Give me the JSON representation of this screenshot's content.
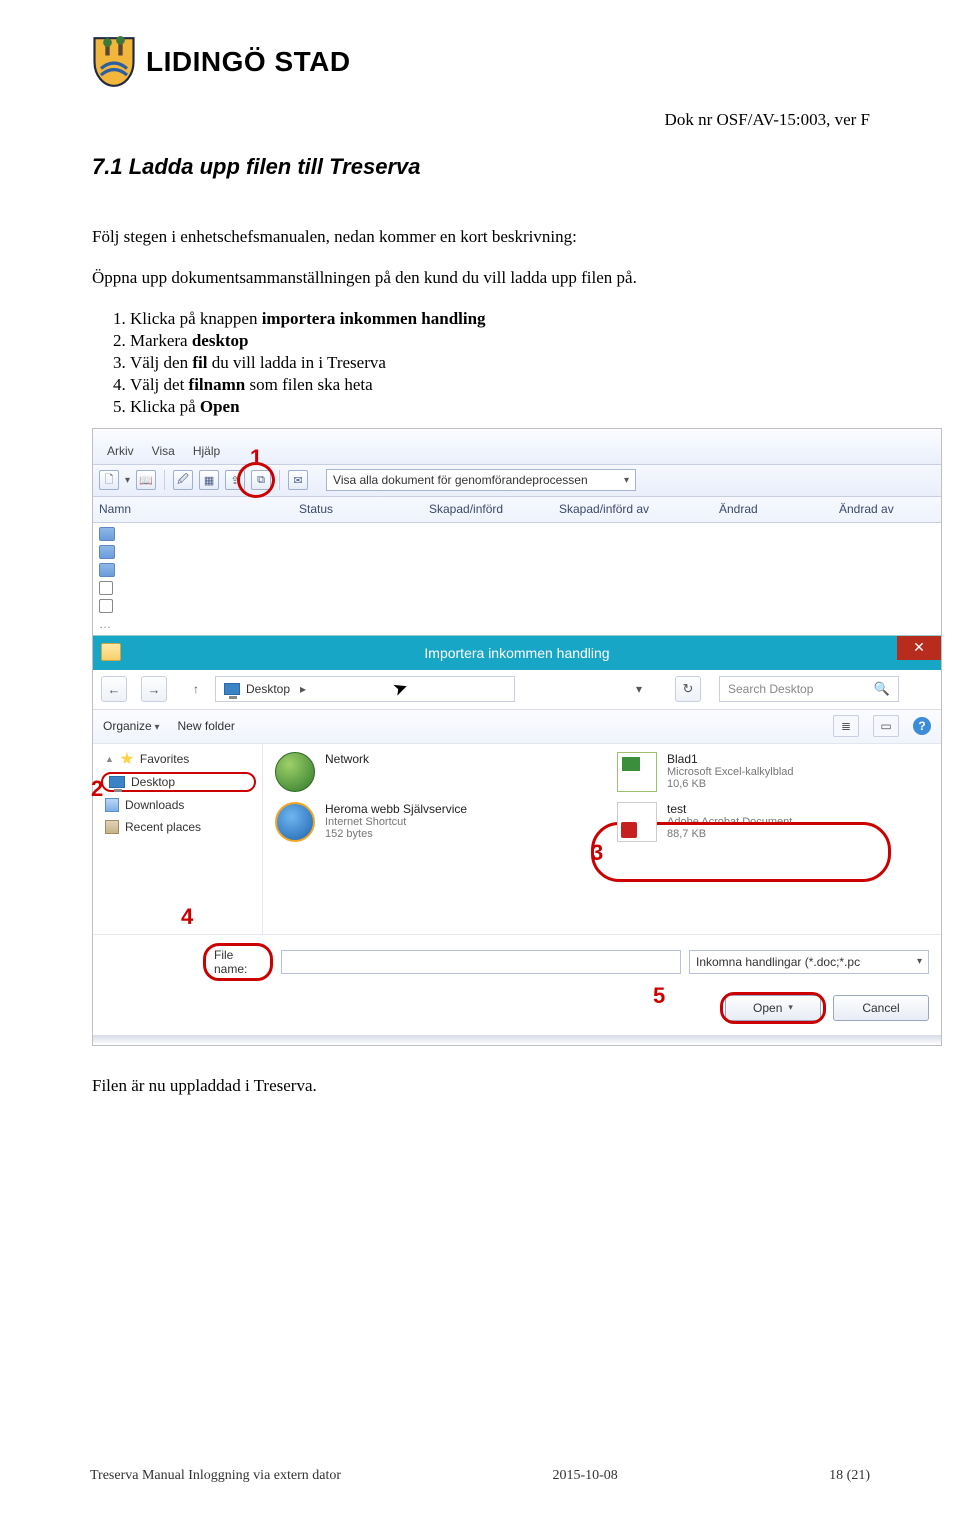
{
  "header": {
    "brand": "LIDINGÖ STAD"
  },
  "doc_nr": "Dok nr OSF/AV-15:003, ver F",
  "section_title": "7.1  Ladda upp filen till Treserva",
  "intro": [
    "Följ stegen i enhetschefsmanualen, nedan kommer en kort beskrivning:",
    "Öppna upp dokumentsammanställningen på den kund du vill ladda upp filen på."
  ],
  "steps": [
    {
      "pre": "Klicka på knappen ",
      "bold": "importera inkommen handling",
      "post": ""
    },
    {
      "pre": "Markera ",
      "bold": "desktop",
      "post": ""
    },
    {
      "pre": "Välj den ",
      "bold": "fil",
      "post": " du vill ladda in i Treserva"
    },
    {
      "pre": "Välj det ",
      "bold": "filnamn",
      "post": " som filen ska heta"
    },
    {
      "pre": "Klicka på ",
      "bold": "Open",
      "post": ""
    }
  ],
  "shot": {
    "menus": {
      "arkiv": "Arkiv",
      "visa": "Visa",
      "hjalp": "Hjälp"
    },
    "marker1": "1",
    "dropdown": "Visa alla dokument för genomförandeprocessen",
    "columns": [
      "Namn",
      "Status",
      "Skapad/införd",
      "Skapad/införd av",
      "Ändrad",
      "Ändrad av"
    ],
    "dialog": {
      "title": "Importera inkommen handling",
      "close": "✕",
      "nav_back": "←",
      "nav_fwd": "→",
      "up": "↑",
      "location_label": "Desktop",
      "chevron": "▸",
      "loc_drop": "▾",
      "refresh": "↻",
      "search_placeholder": "Search Desktop",
      "search_icon": "🔍",
      "organize": "Organize",
      "newfolder": "New folder",
      "views_label": "≣",
      "help": "?",
      "sidebar": {
        "favorites": "Favorites",
        "desktop": "Desktop",
        "downloads": "Downloads",
        "recent": "Recent places"
      },
      "markers": {
        "m2": "2",
        "m3": "3",
        "m4": "4",
        "m5": "5"
      },
      "files": {
        "network": {
          "title": "Network"
        },
        "heroma": {
          "title": "Heroma webb Självservice",
          "sub1": "Internet Shortcut",
          "sub2": "152 bytes"
        },
        "blad1": {
          "title": "Blad1",
          "sub1": "Microsoft Excel-kalkylblad",
          "sub2": "10,6 KB"
        },
        "test": {
          "title": "test",
          "sub1": "Adobe Acrobat Document",
          "sub2": "88,7 KB"
        }
      },
      "fn_label": "File name:",
      "ft_label": "Inkomna handlingar (*.doc;*.pc",
      "open_btn": "Open",
      "cancel_btn": "Cancel"
    }
  },
  "after": "Filen är nu uppladdad i Treserva.",
  "footer": {
    "left": "Treserva Manual Inloggning via extern dator",
    "mid": "2015-10-08",
    "right": "18 (21)"
  }
}
